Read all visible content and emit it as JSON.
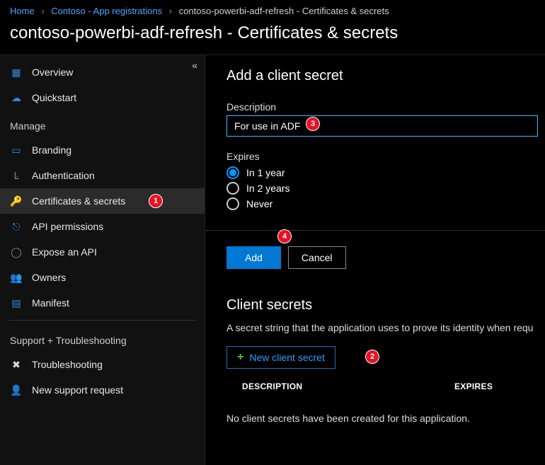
{
  "breadcrumb": {
    "home": "Home",
    "parent": "Contoso - App registrations",
    "current": "contoso-powerbi-adf-refresh - Certificates & secrets"
  },
  "page_title": "contoso-powerbi-adf-refresh - Certificates & secrets",
  "sidebar": {
    "overview": "Overview",
    "quickstart": "Quickstart",
    "section_manage": "Manage",
    "branding": "Branding",
    "authentication": "Authentication",
    "certs": "Certificates & secrets",
    "api_permissions": "API permissions",
    "expose_api": "Expose an API",
    "owners": "Owners",
    "manifest": "Manifest",
    "section_support": "Support + Troubleshooting",
    "troubleshooting": "Troubleshooting",
    "new_support": "New support request"
  },
  "panel": {
    "title": "Add a client secret",
    "description_label": "Description",
    "description_value": "For use in ADF",
    "expires_label": "Expires",
    "opt_1y": "In 1 year",
    "opt_2y": "In 2 years",
    "opt_never": "Never",
    "selected": "1y",
    "add_btn": "Add",
    "cancel_btn": "Cancel"
  },
  "secrets": {
    "title": "Client secrets",
    "desc": "A secret string that the application uses to prove its identity when requ",
    "new_btn": "New client secret",
    "th_desc": "DESCRIPTION",
    "th_expires": "EXPIRES",
    "empty": "No client secrets have been created for this application."
  },
  "callouts": {
    "c1": "1",
    "c2": "2",
    "c3": "3",
    "c4": "4"
  }
}
